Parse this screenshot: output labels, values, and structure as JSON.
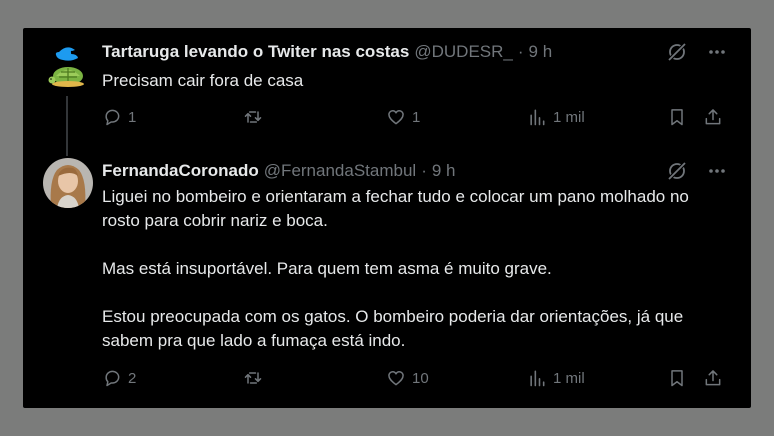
{
  "tweets": [
    {
      "display_name": "Tartaruga levando o Twiter nas costas",
      "handle": "@DUDESR_",
      "separator": "·",
      "time": "9 h",
      "paragraphs": [
        "Precisam cair fora de casa"
      ],
      "actions": {
        "replies": "1",
        "retweets": "",
        "likes": "1",
        "views": "1 mil"
      },
      "avatar": "turtle-bird-avatar"
    },
    {
      "display_name": "FernandaCoronado",
      "handle": "@FernandaStambul",
      "separator": "·",
      "time": "9 h",
      "paragraphs": [
        "Liguei no bombeiro e orientaram a fechar tudo e colocar um pano molhado no rosto para cobrir nariz e boca.",
        "Mas está insuportável. Para quem tem asma é muito grave.",
        "Estou preocupada com os gatos. O bombeiro poderia dar orientações, já que sabem pra que lado a fumaça está indo."
      ],
      "actions": {
        "replies": "2",
        "retweets": "",
        "likes": "10",
        "views": "1 mil"
      },
      "avatar": "woman-photo-avatar"
    }
  ],
  "colors": {
    "background": "#000000",
    "text": "#e7e9ea",
    "muted": "#71767b",
    "frame": "#7b7c7b"
  },
  "icons": [
    "grok-icon",
    "more-icon",
    "reply-icon",
    "retweet-icon",
    "like-icon",
    "views-icon",
    "bookmark-icon",
    "share-icon"
  ]
}
